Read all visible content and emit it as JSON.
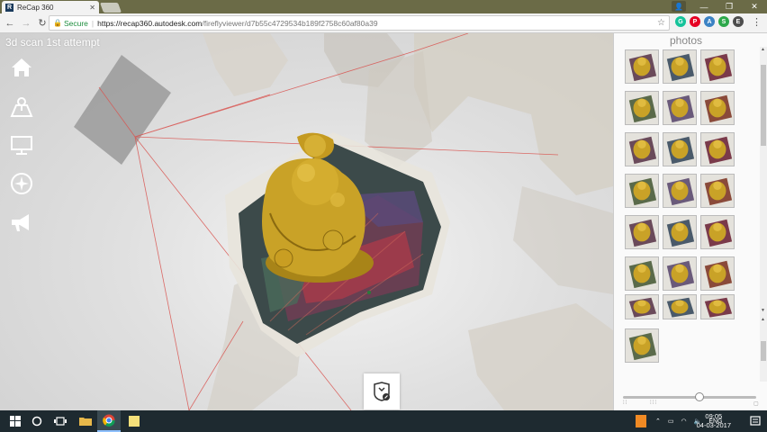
{
  "browser": {
    "tab_title": "ReCap 360",
    "tab_favicon_letter": "R",
    "secure_label": "Secure",
    "url_host": "https://recap360.autodesk.com",
    "url_path": "/fireflyviewer/d7b55c4729534b189f2758c60af80a39"
  },
  "viewer": {
    "scan_title": "3d scan 1st attempt"
  },
  "photos_panel": {
    "title": "photos",
    "thumb_count": 22
  },
  "taskbar": {
    "tray_language": "ENG",
    "time": "09:05",
    "date": "04-03-2017"
  },
  "colors": {
    "browser_frame": "#6b6b47",
    "taskbar": "#1e2a30",
    "laser_line": "#d9534f",
    "figurine_gold": "#c9a227"
  }
}
